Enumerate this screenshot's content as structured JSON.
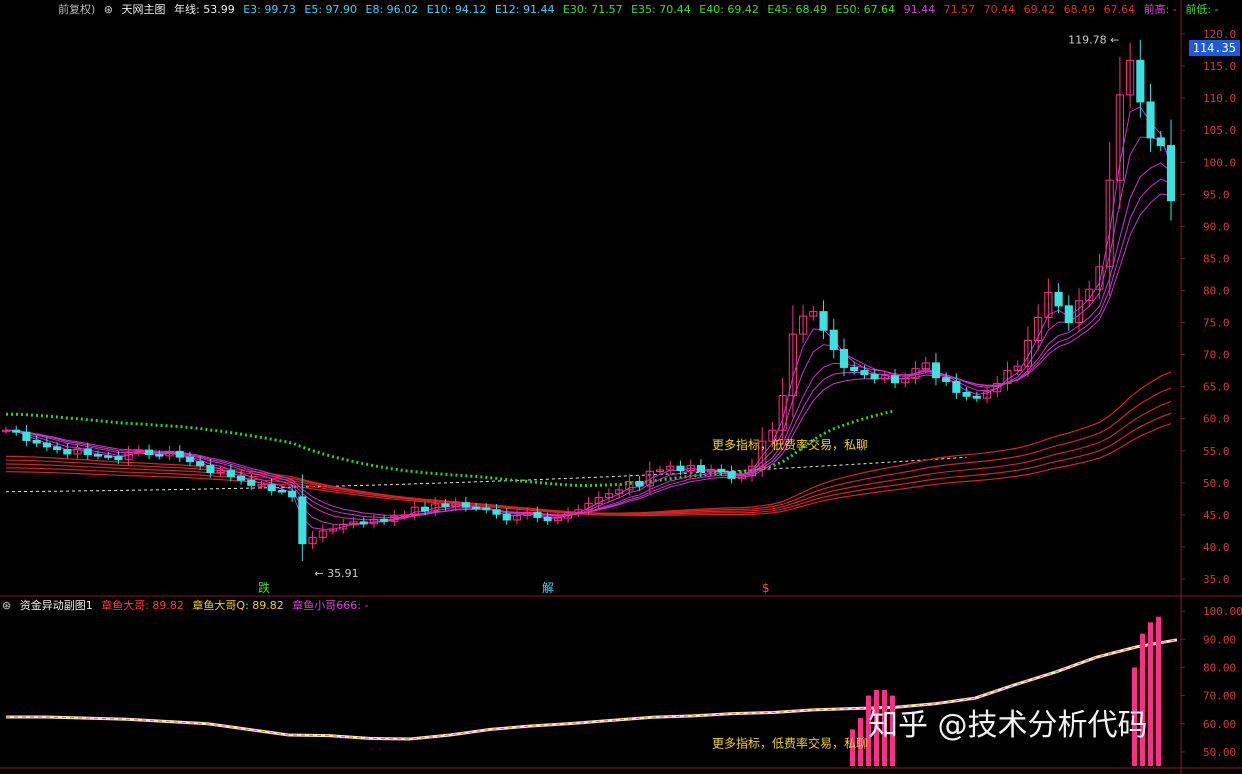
{
  "header_main": {
    "adjust": "前复权)",
    "title": "天网主图",
    "yearline": "年线: 53.99",
    "emas": [
      "E3: 99.73",
      "E5: 97.90",
      "E8: 96.02",
      "E10: 94.12",
      "E12: 91.44",
      "E30: 71.57",
      "E35: 70.44",
      "E40: 69.42",
      "E45: 68.49",
      "E50: 67.64"
    ],
    "tail": [
      "91.44",
      "71.57",
      "70.44",
      "69.42",
      "68.49",
      "67.64"
    ],
    "prev_high": "前高: -",
    "prev_low": "前低: -"
  },
  "header_sub": {
    "title": "资金异动副图1",
    "a": "章鱼大哥: 89.82",
    "b": "章鱼大哥Q: 89.82",
    "c": "章鱼小哥666: -"
  },
  "current_price": "114.35",
  "watermark": "知乎 @技术分析代码",
  "annotations": {
    "high_label": "119.78",
    "low_label": "35.91",
    "promo_main": "更多指标，低费率交易，私聊",
    "promo_sub": "更多指标，低费率交易，私聊",
    "mark_die": "跌",
    "mark_jie": "解",
    "mark_s": "$"
  },
  "colors": {
    "up": "#ff2e8a",
    "down": "#3ee0e0",
    "yellow": "#f2d21b",
    "ema_long": "#d42323",
    "ema_short": "#cc33cc",
    "axis": "#8a1818"
  },
  "chart_data": {
    "type": "candlestick",
    "y_axis_main": {
      "ticks": [
        120.0,
        115.0,
        110.0,
        105.0,
        100.0,
        95.0,
        90.0,
        85.0,
        80.0,
        75.0,
        70.0,
        65.0,
        60.0,
        55.0,
        50.0,
        45.0,
        40.0,
        35.0
      ],
      "range": [
        32.5,
        122.5
      ]
    },
    "y_axis_sub": {
      "ticks": [
        100.0,
        90.0,
        80.0,
        70.0,
        60.0,
        50.0
      ],
      "range": [
        45,
        105
      ]
    },
    "closes": [
      58.2,
      57.9,
      56.6,
      56.2,
      55.6,
      55.2,
      54.5,
      55.3,
      54.4,
      54.2,
      54.1,
      53.6,
      54.7,
      55.1,
      54.4,
      54.2,
      54.9,
      54.0,
      53.3,
      52.7,
      51.6,
      51.9,
      51.0,
      50.4,
      49.6,
      49.7,
      48.8,
      48.7,
      47.8,
      40.5,
      41.5,
      42.5,
      42.8,
      43.5,
      43.9,
      43.6,
      44.3,
      44.0,
      44.8,
      45.0,
      46.2,
      45.6,
      46.7,
      46.3,
      46.9,
      46.2,
      46.1,
      45.8,
      45.1,
      44.2,
      44.9,
      45.4,
      44.6,
      44.1,
      44.5,
      45.3,
      45.8,
      46.8,
      47.7,
      48.3,
      48.9,
      50.2,
      49.5,
      51.8,
      52.0,
      52.6,
      51.9,
      52.7,
      51.7,
      52.1,
      51.7,
      50.7,
      51.1,
      52.6,
      56.5,
      58.2,
      63.6,
      73.2,
      76.0,
      76.7,
      73.8,
      70.8,
      68.0,
      67.5,
      66.9,
      66.2,
      66.7,
      65.6,
      66.3,
      67.8,
      68.7,
      66.4,
      65.8,
      64.1,
      63.5,
      63.2,
      64.2,
      65.5,
      67.5,
      68.2,
      72.2,
      75.8,
      79.7,
      77.6,
      75.0,
      78.4,
      80.2,
      83.7,
      97.2,
      110.5,
      115.9,
      109.4,
      103.8,
      102.6,
      94.0
    ],
    "long_ema_end": 67.64,
    "yearline_end": 53.99,
    "high": 119.78,
    "low": 35.91,
    "sub_line": [
      62.4,
      62.4,
      62.0,
      61.6,
      60.8,
      60.0,
      58.0,
      56.0,
      55.8,
      54.8,
      54.6,
      56.0,
      58.0,
      59.2,
      60.1,
      61.2,
      62.3,
      62.8,
      63.6,
      64.0,
      64.9,
      65.4,
      65.8,
      67.1,
      69.1,
      73.9,
      78.4,
      83.6,
      87.3,
      89.8
    ]
  }
}
